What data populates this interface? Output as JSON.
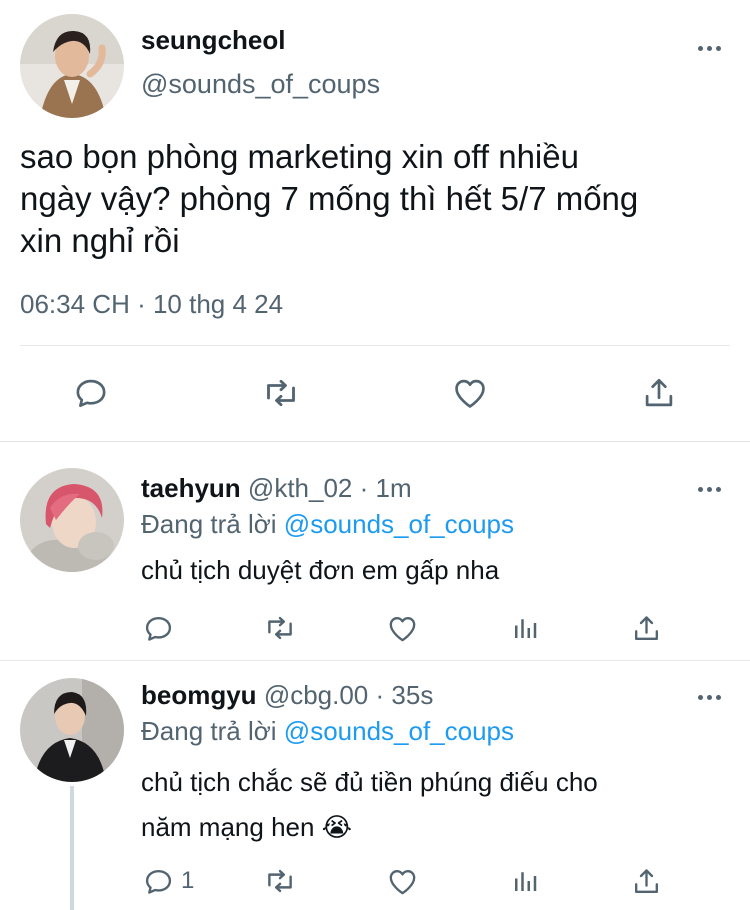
{
  "main_tweet": {
    "display_name": "seungcheol",
    "handle": "@sounds_of_coups",
    "text_line1": "sao bọn phòng marketing xin off nhiều",
    "text_line2": "ngày vậy? phòng 7 mống thì hết 5/7 mống",
    "text_line3": "xin nghỉ rồi",
    "timestamp": "06:34 CH · 10 thg 4 24",
    "icons": [
      "reply-icon",
      "retweet-icon",
      "like-icon",
      "share-icon"
    ]
  },
  "replies": [
    {
      "display_name": "taehyun",
      "handle": "@kth_02",
      "time": "· 1m",
      "replying_prefix": "Đang trả lời",
      "replying_to": "@sounds_of_coups",
      "text_line1": "chủ tịch duyệt đơn em gấp nha",
      "text_line2": "",
      "reply_count": ""
    },
    {
      "display_name": "beomgyu",
      "handle": "@cbg.00",
      "time": "· 35s",
      "replying_prefix": "Đang trả lời",
      "replying_to": "@sounds_of_coups",
      "text_line1": "chủ tịch chắc sẽ đủ tiền phúng điếu cho",
      "text_line2": "năm mạng hen 😭",
      "reply_count": "1"
    }
  ],
  "colors": {
    "accent": "#1d9bf0",
    "muted": "#536471",
    "divider": "#e6e9ec"
  }
}
